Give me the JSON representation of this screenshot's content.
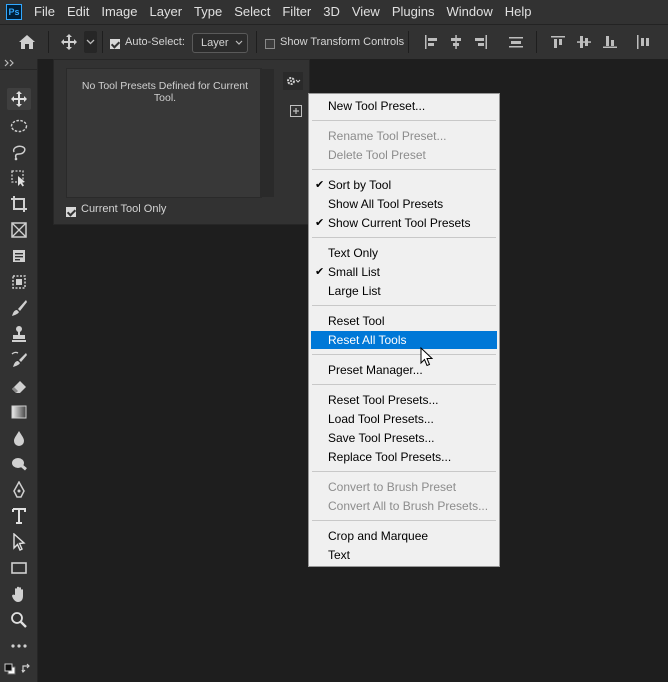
{
  "app": {
    "logo": "Ps"
  },
  "menubar": [
    "File",
    "Edit",
    "Image",
    "Layer",
    "Type",
    "Select",
    "Filter",
    "3D",
    "View",
    "Plugins",
    "Window",
    "Help"
  ],
  "options": {
    "auto_select_label": "Auto-Select:",
    "auto_select_checked": true,
    "layer_select_value": "Layer",
    "show_transform_label": "Show Transform Controls",
    "show_transform_checked": false
  },
  "panel": {
    "empty_message": "No Tool Presets Defined for Current Tool.",
    "current_tool_only_label": "Current Tool Only",
    "current_tool_only_checked": true
  },
  "context_menu": {
    "new_tool_preset": "New Tool Preset...",
    "rename_tool_preset": "Rename Tool Preset...",
    "delete_tool_preset": "Delete Tool Preset",
    "sort_by_tool": "Sort by Tool",
    "show_all_tool_presets": "Show All Tool Presets",
    "show_current_tool_presets": "Show Current Tool Presets",
    "text_only": "Text Only",
    "small_list": "Small List",
    "large_list": "Large List",
    "reset_tool": "Reset Tool",
    "reset_all_tools": "Reset All Tools",
    "preset_manager": "Preset Manager...",
    "reset_tool_presets": "Reset Tool Presets...",
    "load_tool_presets": "Load Tool Presets...",
    "save_tool_presets": "Save Tool Presets...",
    "replace_tool_presets": "Replace Tool Presets...",
    "convert_to_brush_preset": "Convert to Brush Preset",
    "convert_all_to_brush_presets": "Convert All to Brush Presets...",
    "crop_and_marquee": "Crop and Marquee",
    "text": "Text",
    "checkmark": "✔"
  },
  "colors": {
    "highlight": "#0078d7",
    "menu_bg": "#f0f0f0",
    "chrome": "#323232",
    "workspace": "#1e1e1e"
  }
}
